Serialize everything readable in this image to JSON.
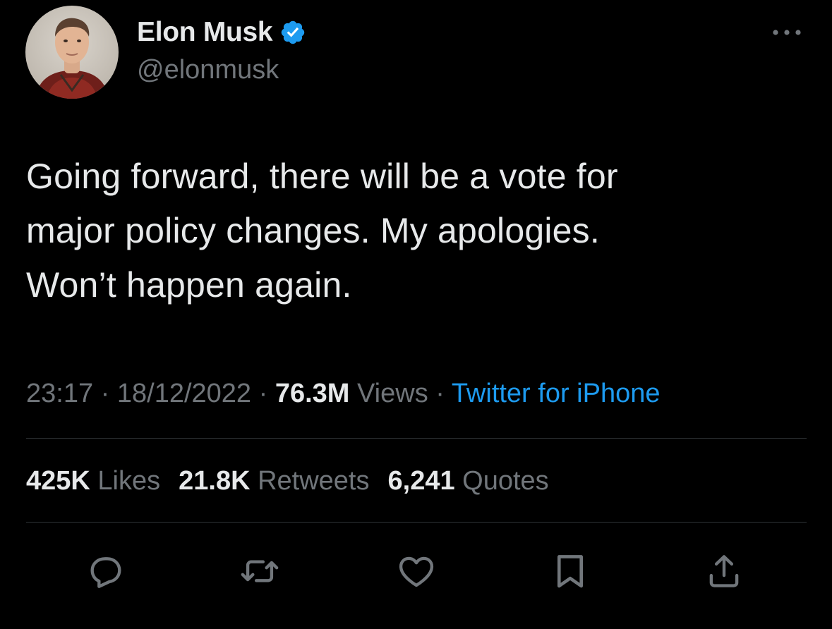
{
  "author": {
    "display_name": "Elon Musk",
    "handle": "@elonmusk",
    "verified_icon": "verified-badge-icon",
    "avatar_icon": "avatar-photo"
  },
  "menu": {
    "more_icon": "more-options-icon",
    "more_glyph": "•••"
  },
  "tweet": {
    "text": "Going forward, there will be a vote for\nmajor policy changes. My apologies.\nWon’t happen again."
  },
  "meta": {
    "time": "23:17",
    "sep1": " · ",
    "date": "18/12/2022",
    "sep2": " · ",
    "views_count": "76.3M",
    "views_label": " Views",
    "sep3": " · ",
    "source": "Twitter for iPhone"
  },
  "stats": {
    "likes_count": "425K",
    "likes_label": " Likes",
    "retweets_count": "21.8K",
    "retweets_label": " Retweets",
    "quotes_count": "6,241",
    "quotes_label": " Quotes"
  },
  "actions": {
    "reply_icon": "reply-icon",
    "retweet_icon": "retweet-icon",
    "like_icon": "like-icon",
    "bookmark_icon": "bookmark-icon",
    "share_icon": "share-icon"
  },
  "colors": {
    "background": "#000000",
    "primary_text": "#e7e9ea",
    "secondary_text": "#71767b",
    "accent": "#1d9bf0",
    "divider": "#2f3336"
  }
}
